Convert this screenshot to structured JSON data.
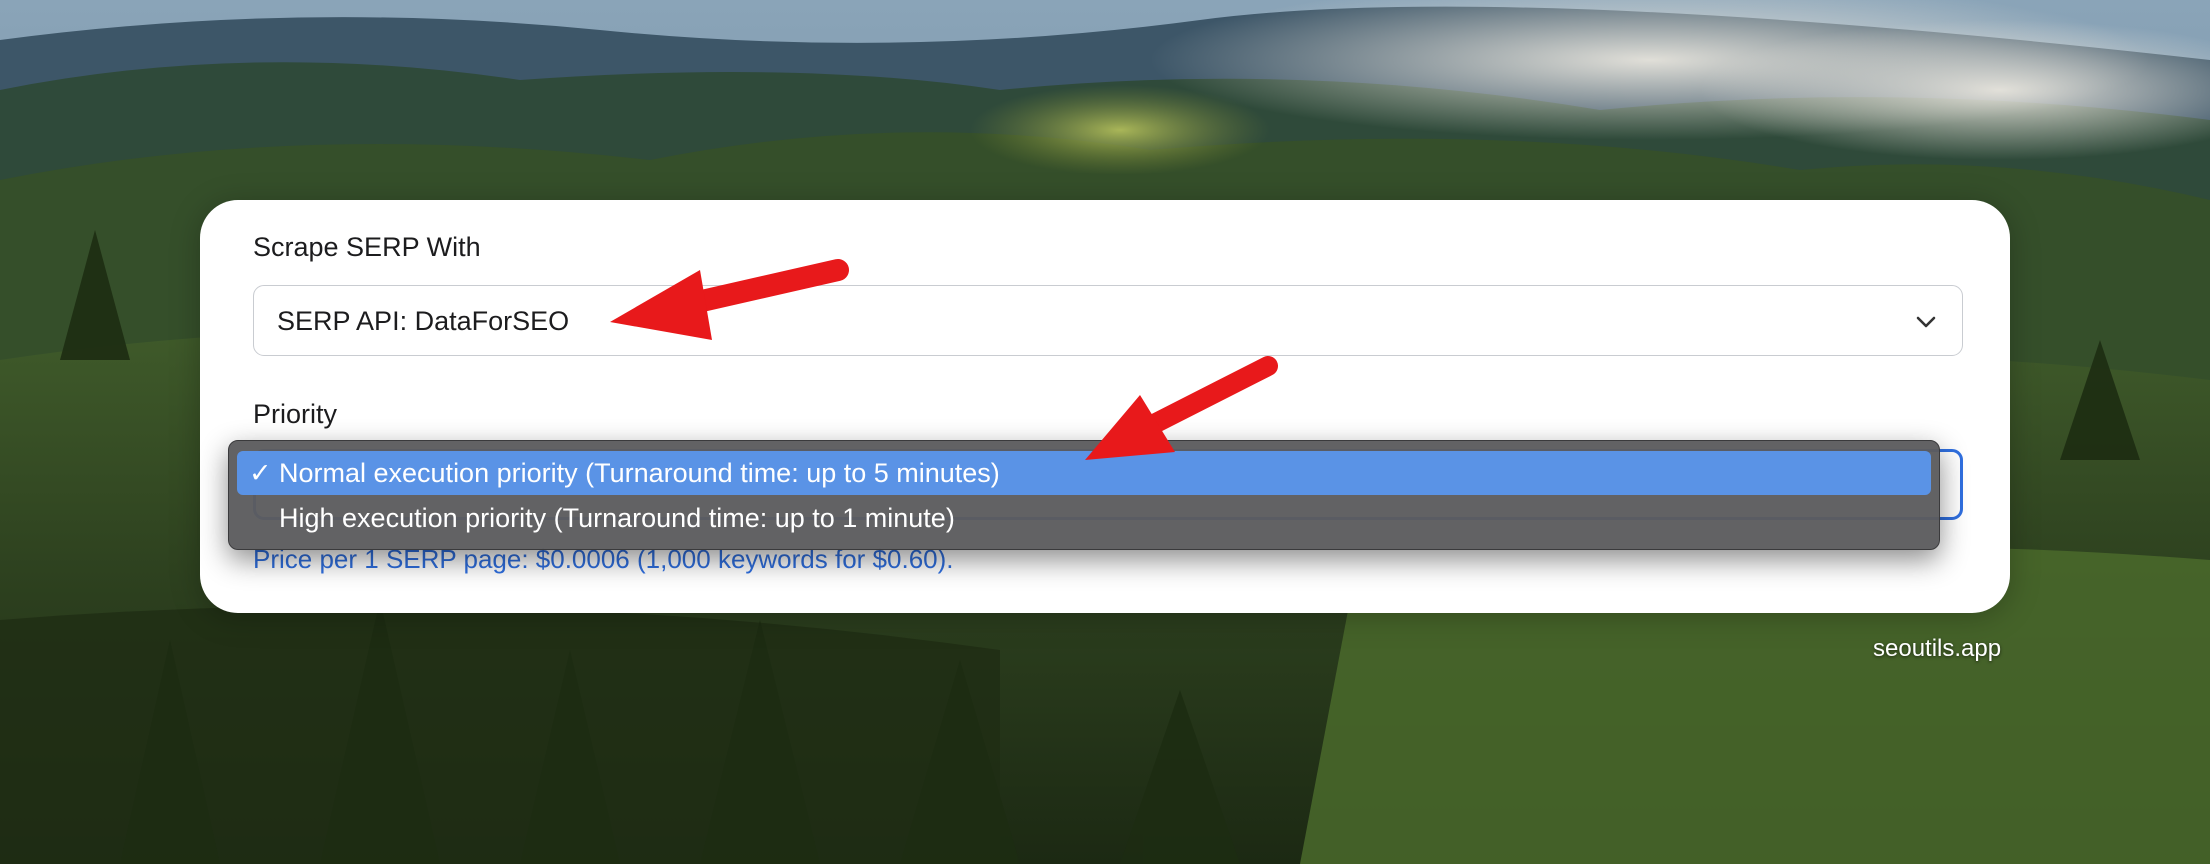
{
  "form": {
    "serp_label": "Scrape SERP With",
    "serp_value": "SERP API: DataForSEO",
    "priority_label": "Priority",
    "price_note": "Price per 1 SERP page: $0.0006 (1,000 keywords for $0.60)."
  },
  "dropdown": {
    "options": [
      {
        "label": "Normal execution priority (Turnaround time: up to 5 minutes)",
        "selected": true
      },
      {
        "label": "High execution priority (Turnaround time: up to 1 minute)",
        "selected": false
      }
    ],
    "check_mark": "✓"
  },
  "watermark": "seoutils.app",
  "colors": {
    "accent": "#2f6fe0",
    "highlight": "#5a93e6",
    "arrow": "#e8191b",
    "menu_bg": "#5c5c5e"
  },
  "icons": {
    "select_chevron": "chevron-down-icon",
    "selected_mark": "checkmark-icon"
  }
}
